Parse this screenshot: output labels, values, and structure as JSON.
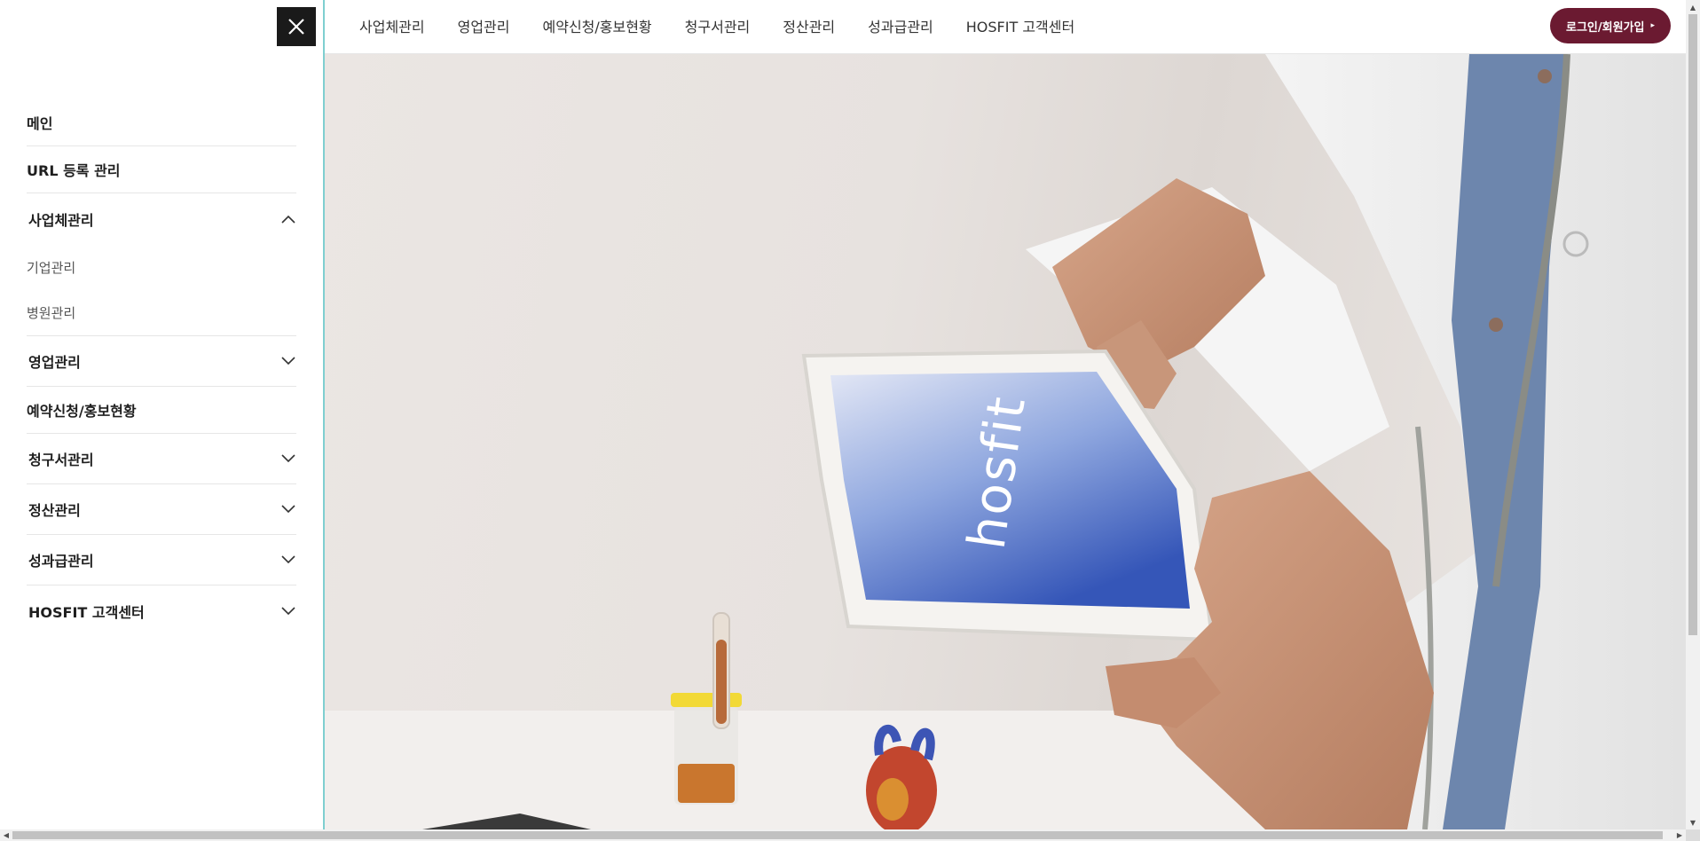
{
  "topnav": {
    "items": [
      "사업체관리",
      "영업관리",
      "예약신청/홍보현황",
      "청구서관리",
      "정산관리",
      "성과급관리",
      "HOSFIT 고객센터"
    ],
    "login_label": "로그인/회원가입",
    "login_arrow": "▸",
    "login_color": "#6b1a31"
  },
  "sidebar": {
    "close_icon": "close-icon",
    "items": [
      {
        "label": "메인",
        "expandable": false
      },
      {
        "label": "URL 등록 관리",
        "expandable": false
      },
      {
        "label": "사업체관리",
        "expandable": true,
        "expanded": true,
        "children": [
          "기업관리",
          "병원관리"
        ]
      },
      {
        "label": "영업관리",
        "expandable": true,
        "expanded": false
      },
      {
        "label": "예약신청/홍보현황",
        "expandable": false
      },
      {
        "label": "청구서관리",
        "expandable": true,
        "expanded": false
      },
      {
        "label": "정산관리",
        "expandable": true,
        "expanded": false
      },
      {
        "label": "성과급관리",
        "expandable": true,
        "expanded": false
      },
      {
        "label": "HOSFIT 고객센터",
        "expandable": true,
        "expanded": false
      }
    ],
    "border_color": "#7fcfd0"
  },
  "hero": {
    "tablet_logo": "hosfit",
    "logo_accent_color": "#3aa9c9"
  },
  "scrollbars": {
    "up": "▲",
    "down": "▼",
    "left": "◀",
    "right": "▶"
  }
}
